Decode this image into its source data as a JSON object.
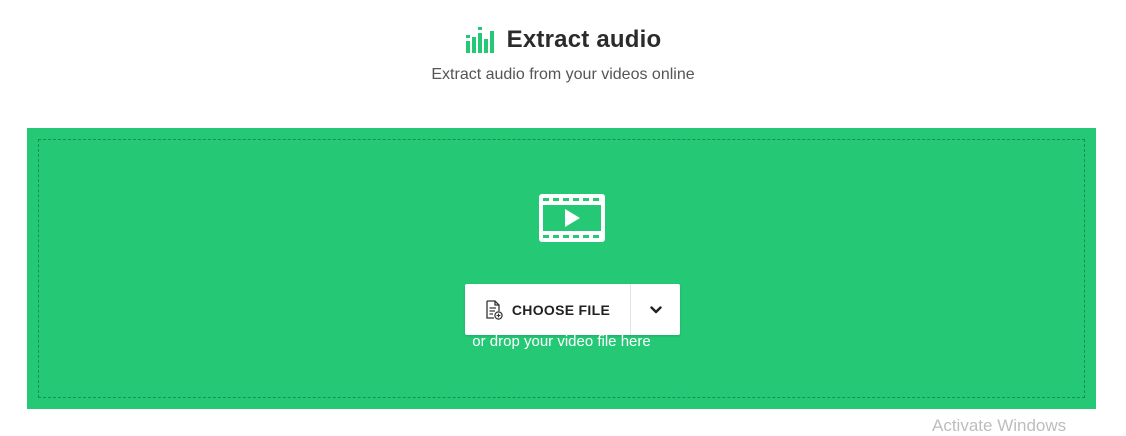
{
  "header": {
    "title": "Extract audio",
    "subtitle": "Extract audio from your videos online",
    "title_icon": "audio-bars-icon"
  },
  "dropzone": {
    "background_color": "#24c875",
    "icon": "video-play-icon",
    "choose_file_label": "CHOOSE FILE",
    "choose_file_icon": "file-add-icon",
    "dropdown_icon": "chevron-down-icon",
    "hint": "or drop your video file here"
  },
  "os_overlay": {
    "watermark": "Activate Windows"
  },
  "colors": {
    "accent_green": "#24c875",
    "title_text": "#2b2b2b",
    "subtitle_text": "#555555"
  }
}
